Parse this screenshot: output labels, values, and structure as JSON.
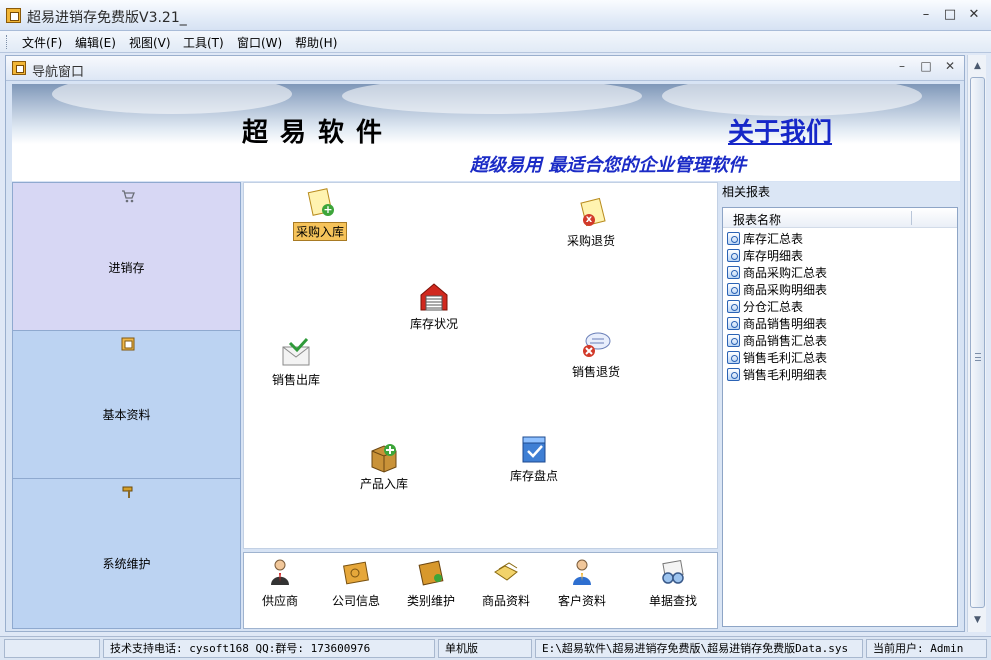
{
  "app": {
    "title": "超易进销存免费版V3.21_"
  },
  "menu": [
    "文件(F)",
    "编辑(E)",
    "视图(V)",
    "工具(T)",
    "窗口(W)",
    "帮助(H)"
  ],
  "nav_window": {
    "title": "导航窗口"
  },
  "banner": {
    "brand": "超易软件",
    "about_link": "关于我们",
    "slogan": "超级易用  最适合您的企业管理软件"
  },
  "left_nav": [
    {
      "label": "进销存",
      "icon": "cart-icon"
    },
    {
      "label": "基本资料",
      "icon": "folder-icon"
    },
    {
      "label": "系统维护",
      "icon": "hammer-icon"
    }
  ],
  "functions": {
    "purchase_in": "采购入库",
    "purchase_return": "采购退货",
    "stock_status": "库存状况",
    "sales_out": "销售出库",
    "sales_return": "销售退货",
    "product_in": "产品入库",
    "stock_check": "库存盘点"
  },
  "quick": [
    "供应商",
    "公司信息",
    "类别维护",
    "商品资料",
    "客户资料",
    "单据查找"
  ],
  "reports": {
    "panel_title": "相关报表",
    "column": "报表名称",
    "items": [
      "库存汇总表",
      "库存明细表",
      "商品采购汇总表",
      "商品采购明细表",
      "分仓汇总表",
      "商品销售明细表",
      "商品销售汇总表",
      "销售毛利汇总表",
      "销售毛利明细表"
    ]
  },
  "status": {
    "support": "技术支持电话: cysoft168 QQ:群号: 173600976",
    "mode": "单机版",
    "path": "E:\\超易软件\\超易进销存免费版\\超易进销存免费版Data.sys",
    "user": "当前用户: Admin"
  },
  "colors": {
    "accent": "#1627c8",
    "nav_active": "#d7d7f4",
    "nav_bg": "#bcd3f2",
    "selected_label": "#f6c35a"
  }
}
